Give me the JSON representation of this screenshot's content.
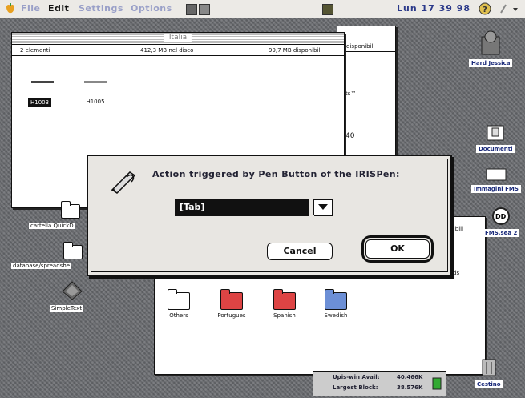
{
  "menubar": {
    "items": [
      "File",
      "Edit",
      "Settings",
      "Options"
    ],
    "active": "Edit",
    "clock": "Lun 17 39 98"
  },
  "window_back": {
    "info_fragment": "B disponibili",
    "fragments": [
      "ts™",
      "40"
    ]
  },
  "window_italia": {
    "title": "Italia",
    "count": "2 elementi",
    "disk": "412,3 MB nel disco",
    "free": "99,7 MB disponibili",
    "icons": [
      "H1003",
      "H1005"
    ]
  },
  "window_languages": {
    "info_fragment": "sponibili",
    "fragment": "ds",
    "folders": [
      {
        "label": "Others",
        "color": "#ffffff"
      },
      {
        "label": "Portugues",
        "color": "#dd4444"
      },
      {
        "label": "Spanish",
        "color": "#dd4444"
      },
      {
        "label": "Swedish",
        "color": "#6c8fd6"
      }
    ]
  },
  "desktop_icons": [
    "cartella QuickD",
    "database/spreadshe",
    "SimpleText"
  ],
  "disks": [
    "Hard Jessica",
    "Documenti",
    "Immagini FMS",
    "FMS.sea 2",
    "Cestino"
  ],
  "dialog": {
    "message": "Action triggered by Pen Button of the IRISPen:",
    "selected": "[Tab]",
    "cancel": "Cancel",
    "ok": "OK"
  },
  "memory": {
    "avail_label": "Upis-win Avail:",
    "avail_value": "40.466K",
    "block_label": "Largest Block:",
    "block_value": "38.576K"
  },
  "colors": {
    "accent": "#2c3a8a",
    "desktop": "#6a6c70"
  }
}
